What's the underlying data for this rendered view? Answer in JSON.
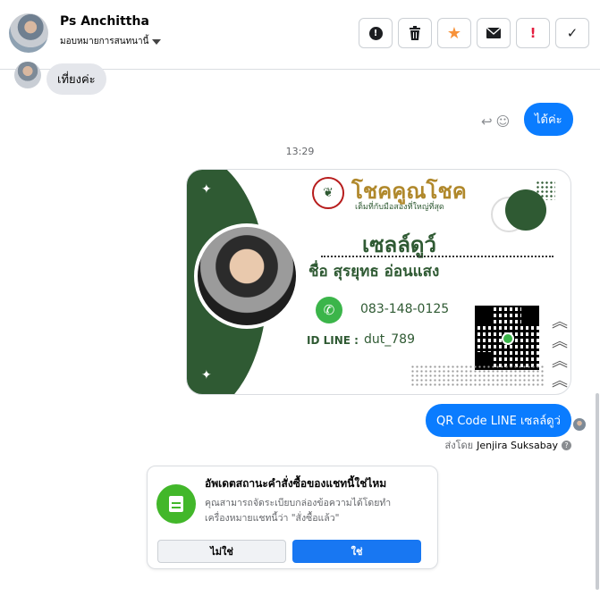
{
  "header": {
    "name": "Ps Anchittha",
    "assign_label": "มอบหมายการสนทนานี้",
    "toolbar": [
      {
        "name": "spam-button",
        "icon": "exclamation-circle-icon",
        "glyph": "❗"
      },
      {
        "name": "delete-button",
        "icon": "trash-icon",
        "glyph": "🗑"
      },
      {
        "name": "star-button",
        "icon": "star-icon",
        "glyph": "★"
      },
      {
        "name": "unread-button",
        "icon": "envelope-icon",
        "glyph": "✉"
      },
      {
        "name": "follow-up-button",
        "icon": "exclamation-icon",
        "glyph": "!"
      },
      {
        "name": "done-button",
        "icon": "check-icon",
        "glyph": "✓"
      }
    ]
  },
  "messages": {
    "incoming_1": "เที่ยงค่ะ",
    "outgoing_1": "ได้ค่ะ",
    "timestamp": "13:29",
    "outgoing_2": "QR Code LINE เซลล์ดูว่",
    "sent_by_prefix": "ส่งโดย",
    "sent_by_name": "Jenjira Suksabay"
  },
  "card": {
    "brand": "โชคคูณโชค",
    "tagline": "เต็มที่กับมือสองที่ใหญ่ที่สุด",
    "nickname": "เซลล์ดูว์",
    "fullname": "ชื่อ สุรยุทธ อ่อนแสง",
    "phone": "083-148-0125",
    "id_label": "ID LINE :",
    "id_value": "dut_789"
  },
  "prompt": {
    "title": "อัพเดตสถานะคำสั่งซื้อของแชทนี้ใช่ไหม",
    "body": "คุณสามารถจัดระเบียบกล่องข้อความได้โดยทำเครื่องหมายแชทนี้ว่า \"สั่งซื้อแล้ว\"",
    "no_label": "ไม่ใช่",
    "yes_label": "ใช่"
  },
  "colors": {
    "accent": "#0a7cff",
    "card_green": "#2f5a33",
    "star": "#f7923a",
    "alert": "#e41e3f"
  }
}
